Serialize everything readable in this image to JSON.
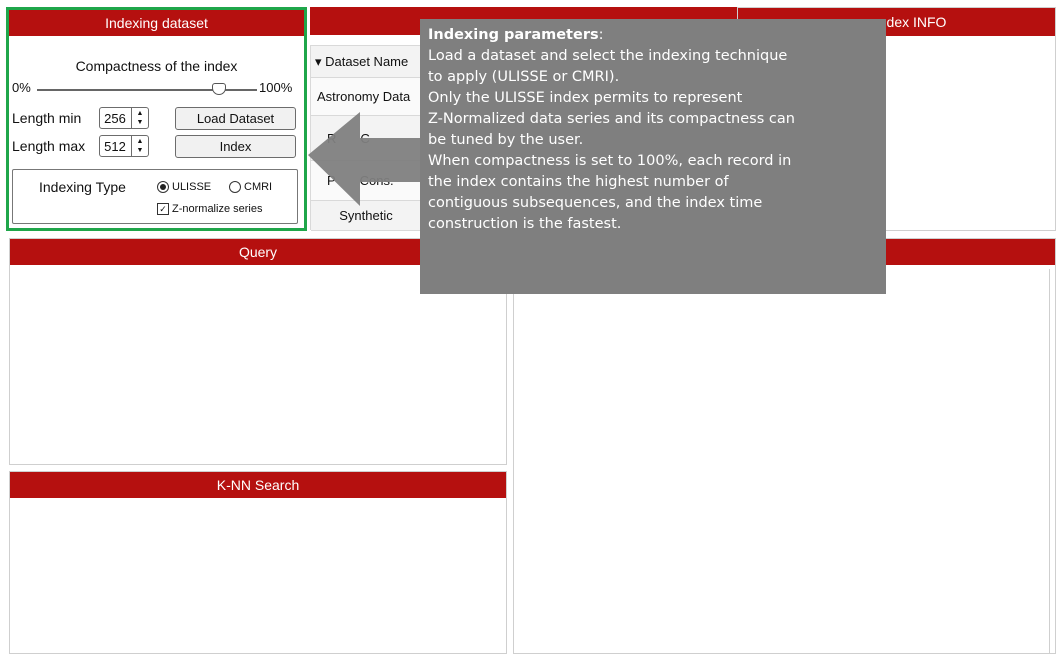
{
  "indexing": {
    "title": "Indexing dataset",
    "compactness_label": "Compactness of the index",
    "slider_min": "0%",
    "slider_max": "100%",
    "compactness_fraction": 0.85,
    "length_min_label": "Length min",
    "length_min_value": "256",
    "length_max_label": "Length max",
    "length_max_value": "512",
    "load_button": "Load Dataset",
    "index_button": "Index",
    "indexing_type_label": "Indexing Type",
    "option_ulisse": "ULISSE",
    "option_cmri": "CMRI",
    "znorm_label": "Z-normalize series",
    "selected_type": "ULISSE",
    "znorm_checked": true
  },
  "datasets": {
    "column_header": "▾ Dataset Name",
    "rows": [
      "Astronomy Data",
      "R",
      "P",
      "Synthetic"
    ],
    "partial_suffix_1": "C",
    "partial_suffix_2": "Cons."
  },
  "index_info": {
    "title_partial": "dex INFO"
  },
  "query": {
    "title": "Query"
  },
  "knn": {
    "title": "K-NN Search"
  },
  "tooltip": {
    "heading": "Indexing parameters",
    "heading_suffix": ":",
    "line1": "Load a dataset and select the indexing technique",
    "line2": "to apply (ULISSE  or CMRI).",
    "line3": "Only the ULISSE index permits to represent",
    "line4": "Z-Normalized data series and its compactness can",
    "line5": "be tuned by the user.",
    "line6": "When compactness is set to 100%, each record in",
    "line7": "the index contains the highest number of",
    "line8": "contiguous subsequences, and the index time",
    "line9": "construction is the fastest."
  },
  "colors": {
    "header_red": "#b5100f",
    "highlight_green": "#1fa64a",
    "tooltip_gray": "#7f7f7f"
  }
}
